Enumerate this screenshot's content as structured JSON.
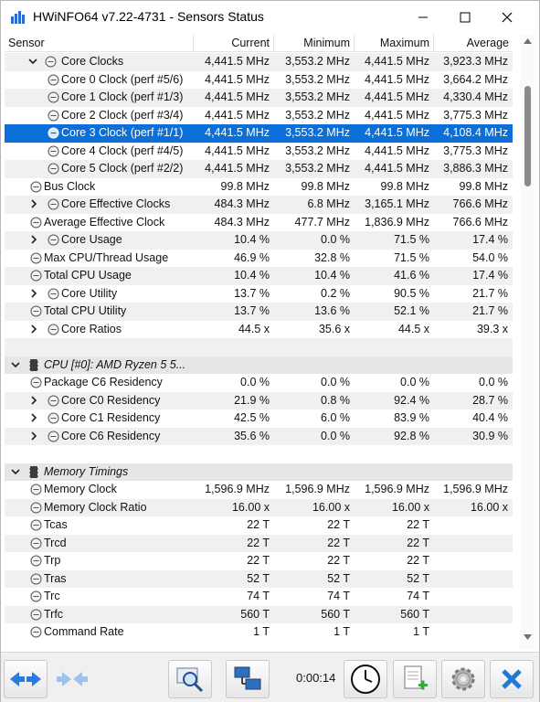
{
  "window": {
    "title": "HWiNFO64 v7.22-4731 - Sensors Status"
  },
  "columns": {
    "sensor": "Sensor",
    "current": "Current",
    "minimum": "Minimum",
    "maximum": "Maximum",
    "average": "Average"
  },
  "rows": [
    {
      "label": "Core Clocks",
      "cur": "4,441.5 MHz",
      "min": "3,553.2 MHz",
      "max": "4,441.5 MHz",
      "avg": "3,923.3 MHz"
    },
    {
      "label": "Core 0 Clock (perf #5/6)",
      "cur": "4,441.5 MHz",
      "min": "3,553.2 MHz",
      "max": "4,441.5 MHz",
      "avg": "3,664.2 MHz"
    },
    {
      "label": "Core 1 Clock (perf #1/3)",
      "cur": "4,441.5 MHz",
      "min": "3,553.2 MHz",
      "max": "4,441.5 MHz",
      "avg": "4,330.4 MHz"
    },
    {
      "label": "Core 2 Clock (perf #3/4)",
      "cur": "4,441.5 MHz",
      "min": "3,553.2 MHz",
      "max": "4,441.5 MHz",
      "avg": "3,775.3 MHz"
    },
    {
      "label": "Core 3 Clock (perf #1/1)",
      "cur": "4,441.5 MHz",
      "min": "3,553.2 MHz",
      "max": "4,441.5 MHz",
      "avg": "4,108.4 MHz"
    },
    {
      "label": "Core 4 Clock (perf #4/5)",
      "cur": "4,441.5 MHz",
      "min": "3,553.2 MHz",
      "max": "4,441.5 MHz",
      "avg": "3,775.3 MHz"
    },
    {
      "label": "Core 5 Clock (perf #2/2)",
      "cur": "4,441.5 MHz",
      "min": "3,553.2 MHz",
      "max": "4,441.5 MHz",
      "avg": "3,886.3 MHz"
    },
    {
      "label": "Bus Clock",
      "cur": "99.8 MHz",
      "min": "99.8 MHz",
      "max": "99.8 MHz",
      "avg": "99.8 MHz"
    },
    {
      "label": "Core Effective Clocks",
      "cur": "484.3 MHz",
      "min": "6.8 MHz",
      "max": "3,165.1 MHz",
      "avg": "766.6 MHz"
    },
    {
      "label": "Average Effective Clock",
      "cur": "484.3 MHz",
      "min": "477.7 MHz",
      "max": "1,836.9 MHz",
      "avg": "766.6 MHz"
    },
    {
      "label": "Core Usage",
      "cur": "10.4 %",
      "min": "0.0 %",
      "max": "71.5 %",
      "avg": "17.4 %"
    },
    {
      "label": "Max CPU/Thread Usage",
      "cur": "46.9 %",
      "min": "32.8 %",
      "max": "71.5 %",
      "avg": "54.0 %"
    },
    {
      "label": "Total CPU Usage",
      "cur": "10.4 %",
      "min": "10.4 %",
      "max": "41.6 %",
      "avg": "17.4 %"
    },
    {
      "label": "Core Utility",
      "cur": "13.7 %",
      "min": "0.2 %",
      "max": "90.5 %",
      "avg": "21.7 %"
    },
    {
      "label": "Total CPU Utility",
      "cur": "13.7 %",
      "min": "13.6 %",
      "max": "52.1 %",
      "avg": "21.7 %"
    },
    {
      "label": "Core Ratios",
      "cur": "44.5 x",
      "min": "35.6 x",
      "max": "44.5 x",
      "avg": "39.3 x"
    },
    {
      "label": "",
      "cur": "",
      "min": "",
      "max": "",
      "avg": ""
    },
    {
      "label": "CPU [#0]: AMD Ryzen 5 5...",
      "cur": "",
      "min": "",
      "max": "",
      "avg": ""
    },
    {
      "label": "Package C6 Residency",
      "cur": "0.0 %",
      "min": "0.0 %",
      "max": "0.0 %",
      "avg": "0.0 %"
    },
    {
      "label": "Core C0 Residency",
      "cur": "21.9 %",
      "min": "0.8 %",
      "max": "92.4 %",
      "avg": "28.7 %"
    },
    {
      "label": "Core C1 Residency",
      "cur": "42.5 %",
      "min": "6.0 %",
      "max": "83.9 %",
      "avg": "40.4 %"
    },
    {
      "label": "Core C6 Residency",
      "cur": "35.6 %",
      "min": "0.0 %",
      "max": "92.8 %",
      "avg": "30.9 %"
    },
    {
      "label": "",
      "cur": "",
      "min": "",
      "max": "",
      "avg": ""
    },
    {
      "label": "Memory Timings",
      "cur": "",
      "min": "",
      "max": "",
      "avg": ""
    },
    {
      "label": "Memory Clock",
      "cur": "1,596.9 MHz",
      "min": "1,596.9 MHz",
      "max": "1,596.9 MHz",
      "avg": "1,596.9 MHz"
    },
    {
      "label": "Memory Clock Ratio",
      "cur": "16.00 x",
      "min": "16.00 x",
      "max": "16.00 x",
      "avg": "16.00 x"
    },
    {
      "label": "Tcas",
      "cur": "22 T",
      "min": "22 T",
      "max": "22 T",
      "avg": ""
    },
    {
      "label": "Trcd",
      "cur": "22 T",
      "min": "22 T",
      "max": "22 T",
      "avg": ""
    },
    {
      "label": "Trp",
      "cur": "22 T",
      "min": "22 T",
      "max": "22 T",
      "avg": ""
    },
    {
      "label": "Tras",
      "cur": "52 T",
      "min": "52 T",
      "max": "52 T",
      "avg": ""
    },
    {
      "label": "Trc",
      "cur": "74 T",
      "min": "74 T",
      "max": "74 T",
      "avg": ""
    },
    {
      "label": "Trfc",
      "cur": "560 T",
      "min": "560 T",
      "max": "560 T",
      "avg": ""
    },
    {
      "label": "Command Rate",
      "cur": "1 T",
      "min": "1 T",
      "max": "1 T",
      "avg": ""
    }
  ],
  "toolbar": {
    "timer": "0:00:14"
  },
  "colors": {
    "selection": "#0a6fd8",
    "alt_row": "#f0f0f0",
    "group_row": "#e6e6e6"
  }
}
